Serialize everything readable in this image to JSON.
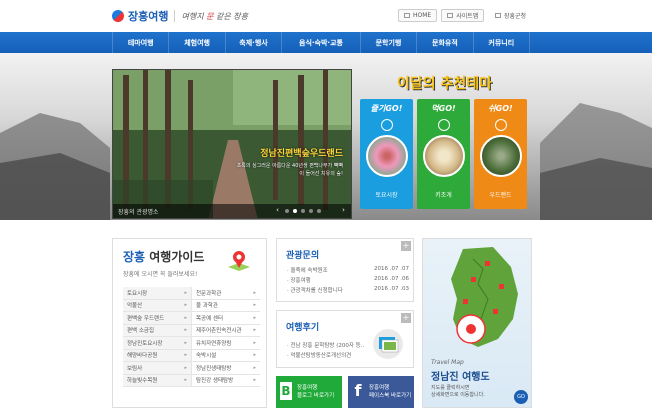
{
  "header": {
    "logo_text": "장흥여행",
    "slogan_prefix": "여행지 ",
    "slogan_accent": "문",
    "slogan_suffix": " 같은 장흥",
    "links": [
      {
        "label": "HOME",
        "icon": "home-icon"
      },
      {
        "label": "사이트맵",
        "icon": "sitemap-icon"
      },
      {
        "label": "장흥군청",
        "icon": "building-icon"
      }
    ]
  },
  "nav": {
    "items": [
      "테마여행",
      "체험여행",
      "축제·행사",
      "음식·숙박·교통",
      "문학기행",
      "문화유적",
      "커뮤니티"
    ]
  },
  "hero": {
    "slide_title": "정남진편백숲우드랜드",
    "slide_desc": "초록의 싱그러운 아름다운 40년생 편백나무가 빽빽이 들어선 치유의 숲!",
    "slide_caption": "장흥의 관광명소",
    "dots_count": 5,
    "active_dot": 1,
    "theme_title": "이달의 추천테마",
    "cards": [
      {
        "head": "즐기GO!",
        "label": "토요시장",
        "color": "#1b9ee0"
      },
      {
        "head": "먹GO!",
        "label": "키조개",
        "color": "#2daa3a"
      },
      {
        "head": "쉬GO!",
        "label": "우드랜드",
        "color": "#f08a16"
      }
    ]
  },
  "guide": {
    "title_a": "장흥",
    "title_b": " 여행가이드",
    "subtitle": "장흥에 오시면 꼭 들러보세요!",
    "rows": [
      [
        "토요시장",
        "천문과학관"
      ],
      [
        "억불산",
        "물 과학관"
      ],
      [
        "편백숲 우드랜드",
        "목공예 센터"
      ],
      [
        "편백 소금집",
        "제주어촌민속전시관"
      ],
      [
        "정남진토요시장",
        "유치자연휴양림"
      ],
      [
        "해양바다공원",
        "숙박시설"
      ],
      [
        "보림사",
        "정남진생태탐방"
      ],
      [
        "하늘빛수목원",
        "탐진강 생태탐방"
      ]
    ]
  },
  "inquiry": {
    "title": "관광문의",
    "items": [
      {
        "text": "· 올죽에 숙박원조",
        "date": "2016 .07 .07"
      },
      {
        "text": "· 장흥여행",
        "date": "2016 .07 .06"
      },
      {
        "text": "· 관광객차를 신청합니다",
        "date": "2016 .07 .03"
      }
    ]
  },
  "review": {
    "title": "여행후기",
    "items": [
      "· 전남 장흥 문학탐방 (200자 등..",
      "· 억불산탐방동산로개선의견"
    ]
  },
  "sns": {
    "blog_line1": "장흥여행",
    "blog_line2": "블로그 바로가기",
    "fb_line1": "장흥여행",
    "fb_line2": "페이스북 바로가기"
  },
  "travelmap": {
    "en": "Travel Map",
    "ko": "정남진 여행도",
    "desc1": "지도를 클릭하시면",
    "desc2": "상세화면으로 이동합니다.",
    "go": "GO"
  }
}
